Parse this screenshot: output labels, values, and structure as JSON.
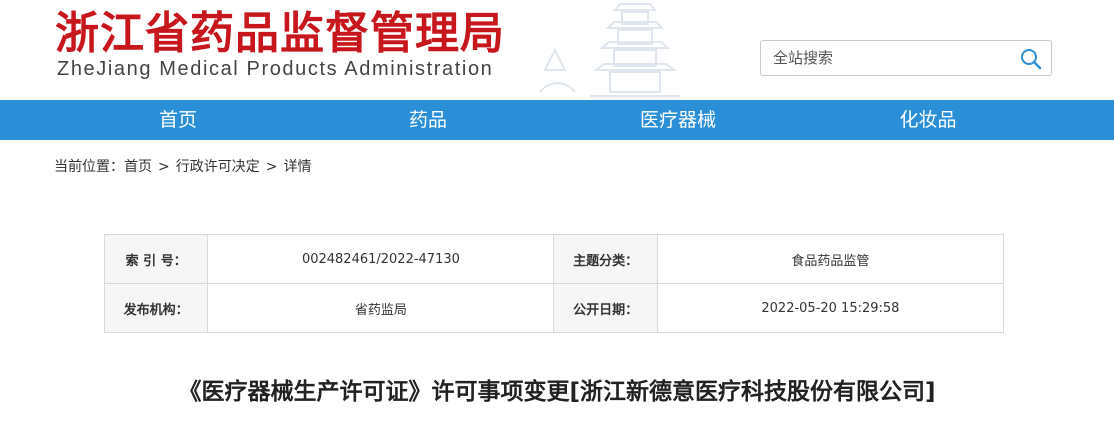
{
  "header": {
    "title_cn": "浙江省药品监督管理局",
    "title_en": "ZheJiang Medical Products Administration",
    "brand_color": "#c8161d"
  },
  "search": {
    "placeholder": "全站搜索",
    "icon": "search-icon"
  },
  "nav": {
    "color": "#2b8fd8",
    "items": [
      {
        "label": "首页"
      },
      {
        "label": "药品"
      },
      {
        "label": "医疗器械"
      },
      {
        "label": "化妆品"
      }
    ]
  },
  "breadcrumb": {
    "prefix": "当前位置：",
    "items": [
      "首页",
      "行政许可决定",
      "详情"
    ],
    "separator": ">"
  },
  "info": {
    "rows": [
      {
        "label1": "索 引 号：",
        "value1": "002482461/2022-47130",
        "label2": "主题分类：",
        "value2": "食品药品监管"
      },
      {
        "label1": "发布机构：",
        "value1": "省药监局",
        "label2": "公开日期：",
        "value2": "2022-05-20 15:29:58"
      }
    ]
  },
  "document": {
    "title": "《医疗器械生产许可证》许可事项变更[浙江新德意医疗科技股份有限公司]"
  }
}
